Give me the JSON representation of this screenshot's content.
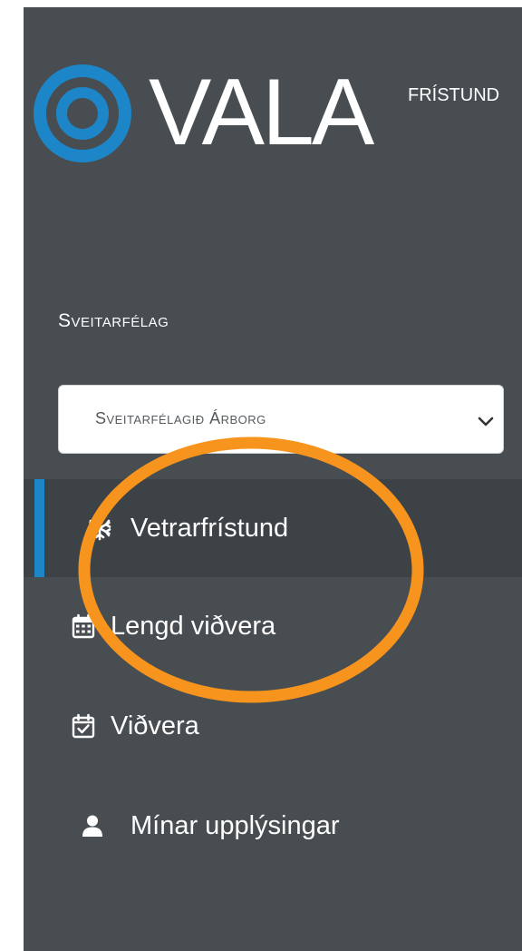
{
  "brand": {
    "name": "VALA",
    "product": "FRÍSTUND",
    "accent": "#1d86c8"
  },
  "municipality": {
    "label": "Sveitarfélag",
    "selected": "Sveitarfélagið Árborg"
  },
  "nav": {
    "items": [
      {
        "label": "Vetrarfrístund",
        "icon": "snowflake-icon",
        "active": true
      },
      {
        "label": "Lengd viðvera",
        "icon": "calendar-icon",
        "active": false
      },
      {
        "label": "Viðvera",
        "icon": "calendar-check-icon",
        "active": false
      },
      {
        "label": "Mínar upplýsingar",
        "icon": "user-icon",
        "active": false
      }
    ]
  },
  "colors": {
    "sidebar_bg": "#474d51",
    "active_bg": "#3c4246",
    "annotation": "#f7941d"
  }
}
